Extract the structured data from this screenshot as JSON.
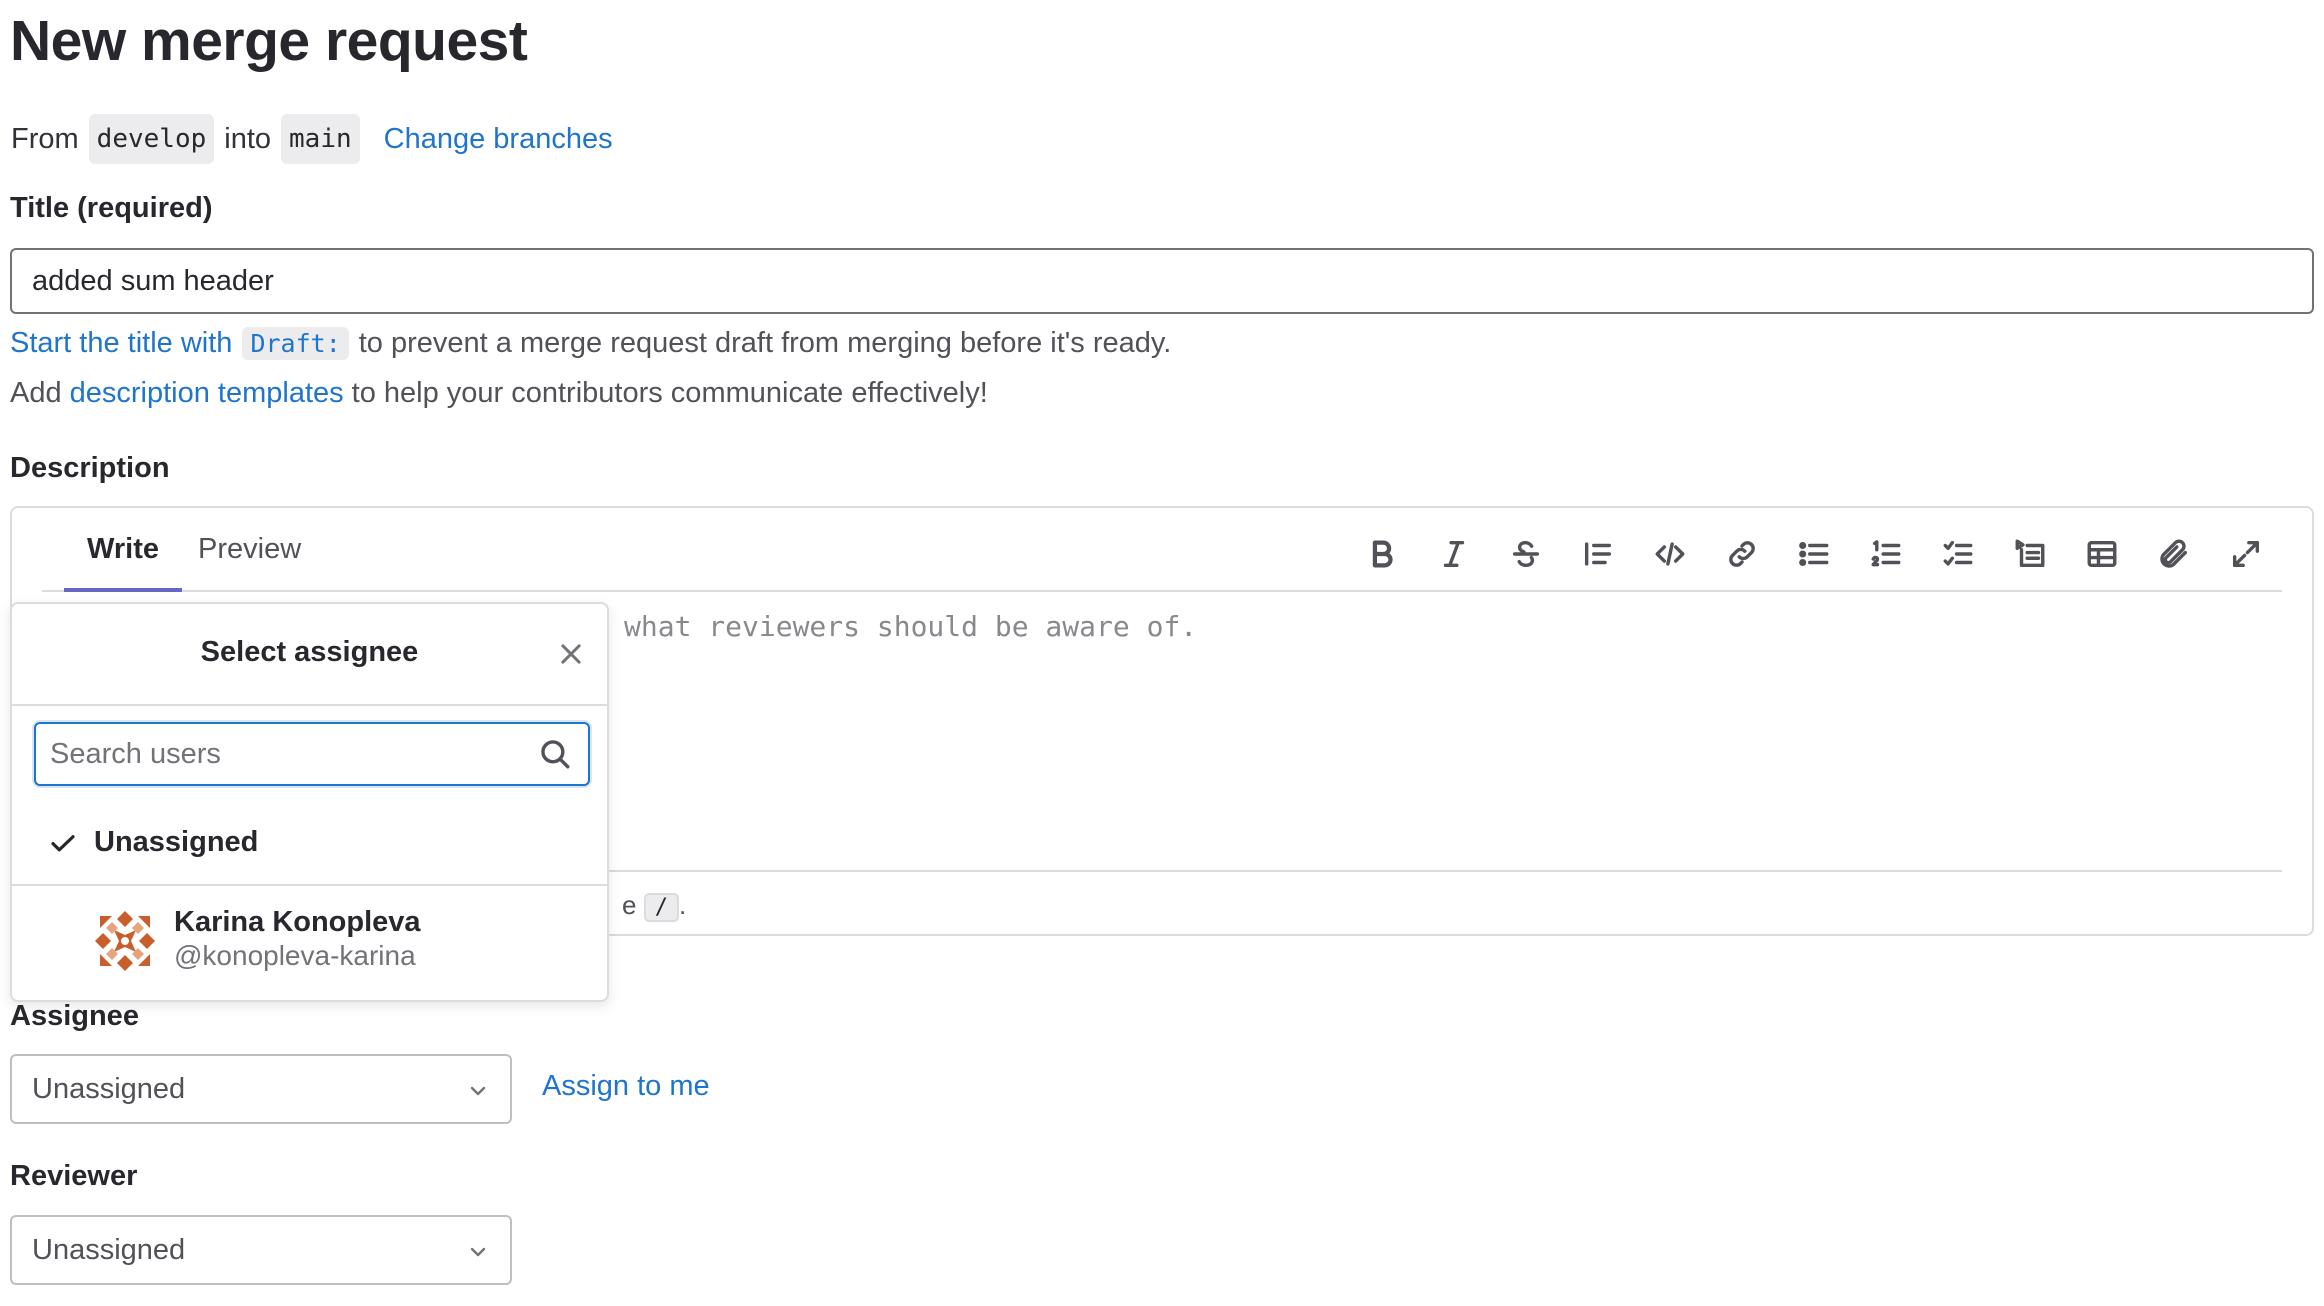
{
  "page": {
    "title": "New merge request"
  },
  "branches": {
    "from_label": "From",
    "source": "develop",
    "into_label": "into",
    "target": "main",
    "change_link": "Change branches"
  },
  "title_field": {
    "label": "Title (required)",
    "value": "added sum header",
    "help_link": "Start the title with",
    "help_code": "Draft:",
    "help_text": "to prevent a merge request draft from merging before it's ready.",
    "templates_prefix": "Add",
    "templates_link": "description templates",
    "templates_suffix": "to help your contributors communicate effectively!"
  },
  "description": {
    "label": "Description",
    "tabs": [
      {
        "label": "Write",
        "active": true
      },
      {
        "label": "Preview",
        "active": false
      }
    ],
    "toolbar_icons": [
      "bold-icon",
      "italic-icon",
      "strikethrough-icon",
      "quote-icon",
      "code-icon",
      "link-icon",
      "bulleted-list-icon",
      "numbered-list-icon",
      "task-list-icon",
      "collapsible-section-icon",
      "table-icon",
      "attach-file-icon",
      "fullscreen-icon"
    ],
    "placeholder_visible": "what reviewers should be aware of.",
    "footer_partial": "e",
    "footer_kbd": "/",
    "footer_end": "."
  },
  "assignee_dropdown": {
    "title": "Select assignee",
    "search_placeholder": "Search users",
    "unassigned_label": "Unassigned",
    "users": [
      {
        "name": "Karina Konopleva",
        "username": "@konopleva-karina"
      }
    ]
  },
  "assignee": {
    "label": "Assignee",
    "selected": "Unassigned",
    "assign_me": "Assign to me"
  },
  "reviewer": {
    "label": "Reviewer",
    "selected": "Unassigned"
  },
  "colors": {
    "link": "#1f75cb",
    "active_tab": "#6666c4",
    "avatar": "#c95d2c"
  }
}
